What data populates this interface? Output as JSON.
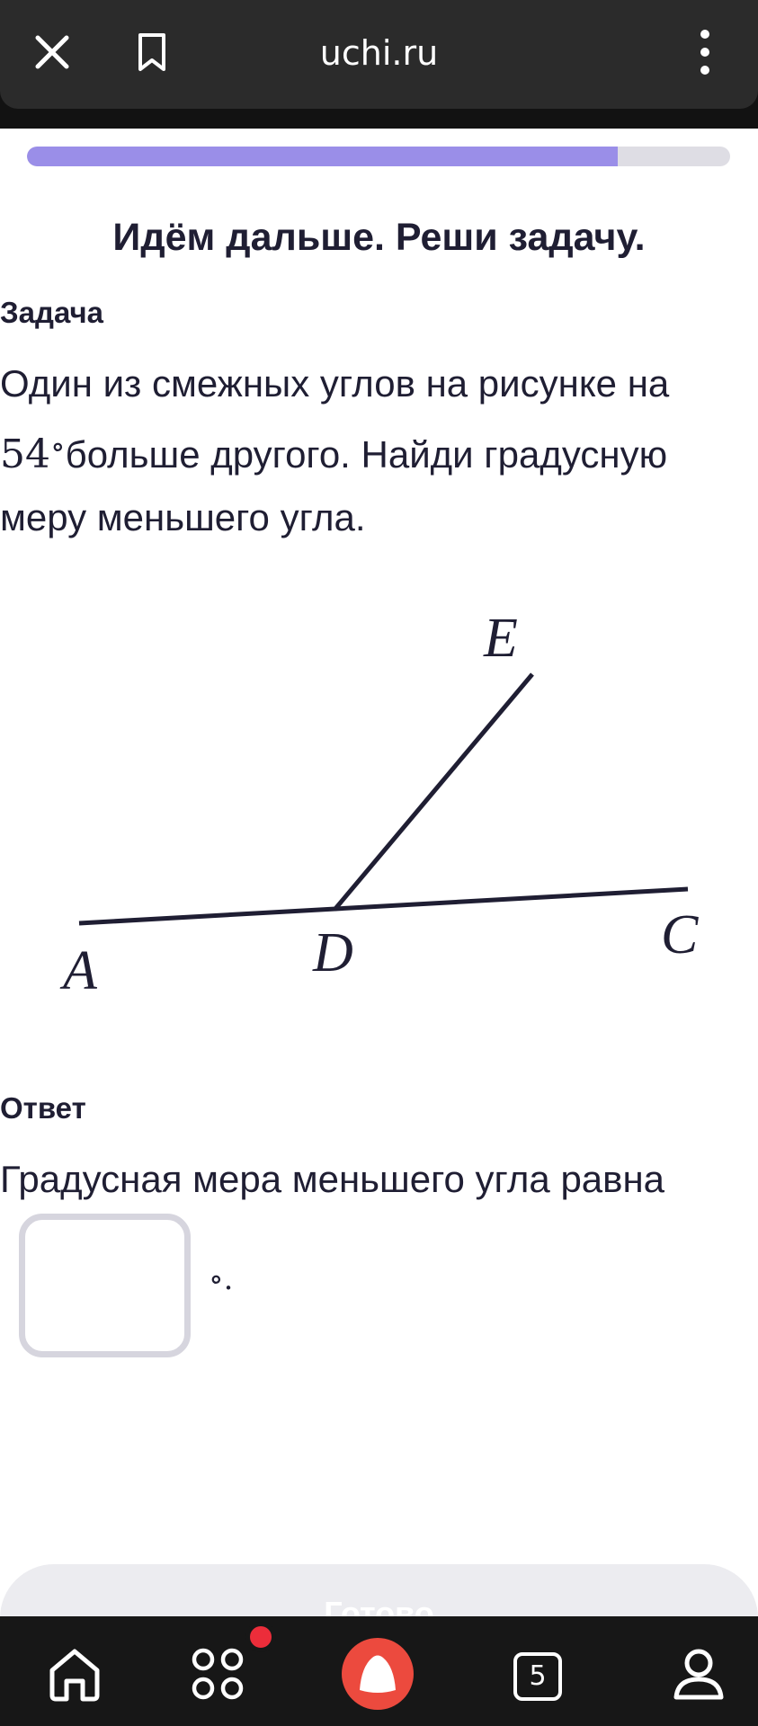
{
  "browser": {
    "url": "uchi.ru",
    "icons": {
      "close": "close-icon",
      "bookmark": "bookmark-icon",
      "menu": "more-vertical-icon"
    }
  },
  "progress": {
    "fraction": 0.84,
    "fill_color": "#9a8ee8",
    "track_color": "#dedde4"
  },
  "main": {
    "heading": "Идём дальше. Реши задачу.",
    "task_label": "Задача",
    "problem": {
      "part1": "Один из смежных углов на рисунке на",
      "number": "54",
      "degree": "∘",
      "part2": "больше другого. Найди градусную меру меньшего угла."
    },
    "figure": {
      "points": {
        "A": "A",
        "D": "D",
        "C": "C",
        "E": "E"
      }
    },
    "answer_label": "Ответ",
    "answer_text": "Градусная мера меньшего угла равна",
    "answer_value": "",
    "answer_unit": "∘."
  },
  "done_button": {
    "label": "Готово"
  },
  "bottom_nav": {
    "tabs_count": "5",
    "icons": {
      "home": "home-icon",
      "apps": "apps-grid-icon",
      "alice": "alice-assistant-icon",
      "tabs": "tabs-icon",
      "profile": "profile-icon"
    },
    "accent_color": "#ec2d3a"
  }
}
